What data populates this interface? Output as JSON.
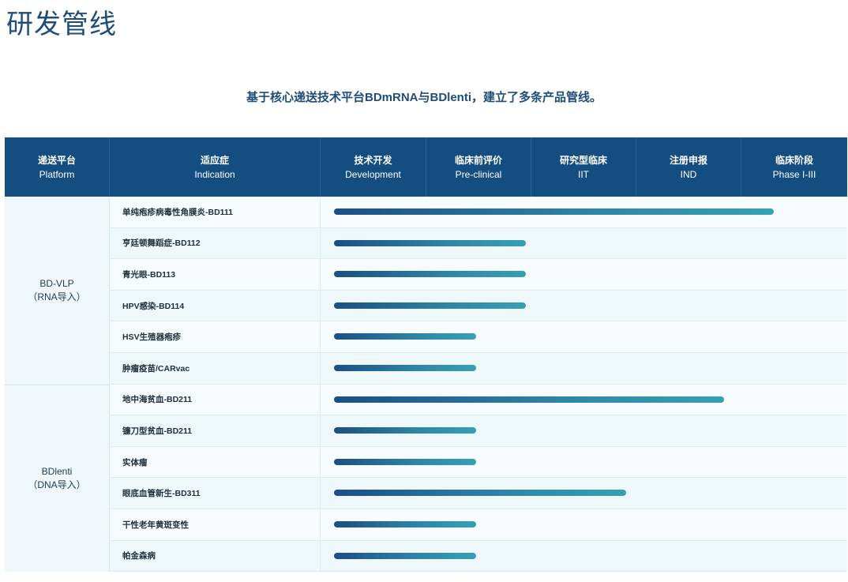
{
  "page_title": "研发管线",
  "subtitle": "基于核心递送技术平台BDmRNA与BDlenti，建立了多条产品管线。",
  "headers": [
    {
      "zh": "递送平台",
      "en": "Platform"
    },
    {
      "zh": "适应症",
      "en": "Indication"
    },
    {
      "zh": "技术开发",
      "en": "Development"
    },
    {
      "zh": "临床前评价",
      "en": "Pre-clinical"
    },
    {
      "zh": "研究型临床",
      "en": "IIT"
    },
    {
      "zh": "注册申报",
      "en": "IND"
    },
    {
      "zh": "临床阶段",
      "en": "Phase I-III"
    }
  ],
  "platforms": [
    {
      "name": "BD-VLP",
      "sub": "（RNA导入）"
    },
    {
      "name": "BDlenti",
      "sub": "（DNA导入）"
    }
  ],
  "chart_data": {
    "type": "bar",
    "orientation": "horizontal",
    "stage_axis": [
      "Development",
      "Pre-clinical",
      "IIT",
      "IND",
      "Phase I-III"
    ],
    "categories": [
      "单纯疱疹病毒性角膜炎-BD111",
      "亨廷顿舞蹈症-BD112",
      "青光眼-BD113",
      "HPV感染-BD114",
      "HSV生殖器疱疹",
      "肿瘤疫苗/CARvac",
      "地中海贫血-BD211",
      "镰刀型贫血-BD211",
      "实体瘤",
      "眼底血管新生-BD311",
      "干性老年黄斑变性",
      "帕金森病"
    ],
    "platform_of_row": [
      0,
      0,
      0,
      0,
      0,
      0,
      1,
      1,
      1,
      1,
      1,
      1
    ],
    "values": [
      4.3,
      1.95,
      1.95,
      1.95,
      1.48,
      1.48,
      3.83,
      1.48,
      1.48,
      2.9,
      1.48,
      1.48
    ],
    "xlim": [
      0,
      5
    ]
  }
}
